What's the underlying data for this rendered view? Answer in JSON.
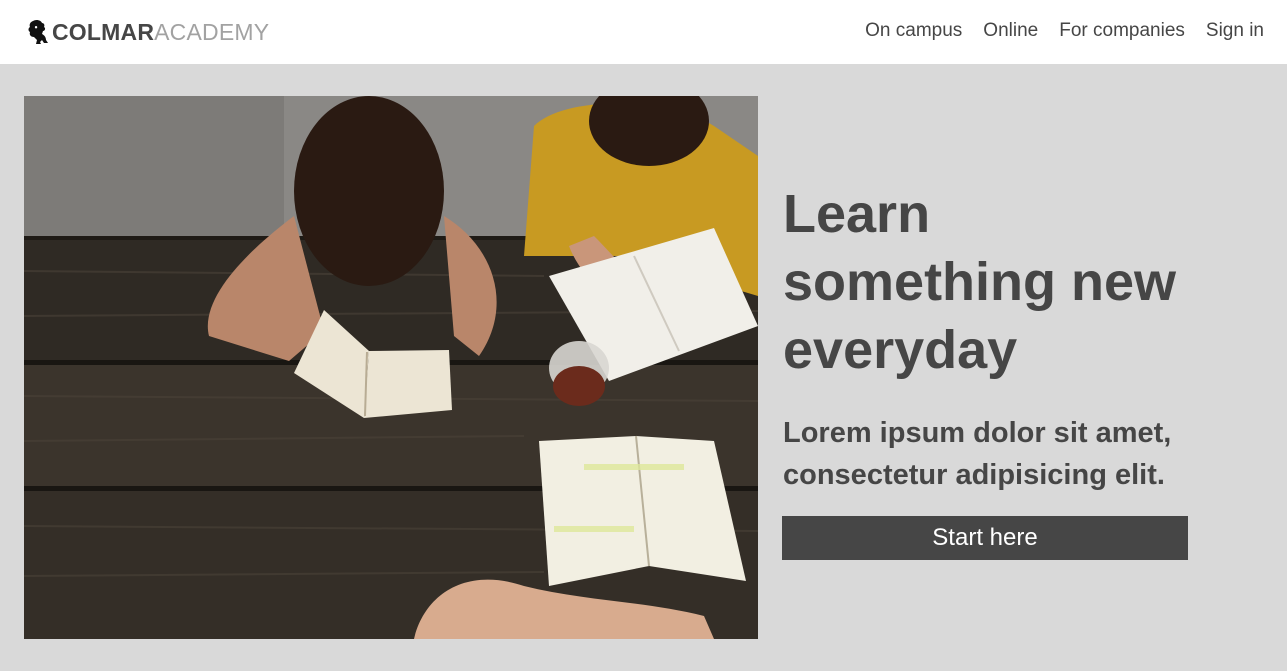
{
  "brand": {
    "part1": "COLMAR",
    "part2": "ACADEMY",
    "icon": "lion-icon"
  },
  "nav": {
    "items": [
      "On campus",
      "Online",
      "For companies",
      "Sign in"
    ]
  },
  "hero": {
    "image_alt": "Students reading books at a wooden table",
    "title": "Learn something new everyday",
    "subtitle": "Lorem ipsum dolor sit amet, consectetur adipisicing elit.",
    "cta_label": "Start here"
  },
  "colors": {
    "text": "#464646",
    "muted": "#a2a2a2",
    "page_bg": "#d9d9d9",
    "header_bg": "#ffffff",
    "button_bg": "#464646"
  }
}
